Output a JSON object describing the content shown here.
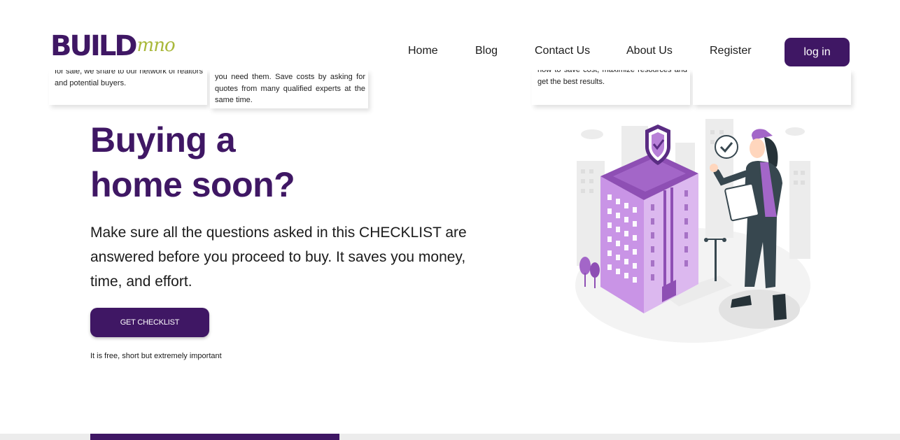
{
  "brand": {
    "logo_main": "BUILD",
    "logo_accent": "mno",
    "primary_color": "#3f1764",
    "accent_color": "#a9b83a"
  },
  "nav": {
    "items": [
      "Home",
      "Blog",
      "Contact Us",
      "About Us",
      "Register"
    ],
    "login_label": "log in"
  },
  "cards": [
    {
      "text": "for sale, we share to our network of realtors and potential buyers."
    },
    {
      "text": "you need them. Save costs by asking for quotes from many qualified experts at the same time."
    },
    {
      "text": "how to save cost, maximize resources and get the best results."
    },
    {
      "text": ""
    }
  ],
  "hero": {
    "title_line1": "Buying a",
    "title_line2": "home soon?",
    "description": "Make sure all the questions asked in this CHECKLIST are answered before you proceed to buy. It saves you money, time, and effort.",
    "cta_label": "GET CHECKLIST",
    "cta_note": "It is free, short but extremely important"
  },
  "illustration": {
    "icon": "building-inspector-illustration"
  },
  "carousel": {
    "progress_fraction": 0.28
  }
}
